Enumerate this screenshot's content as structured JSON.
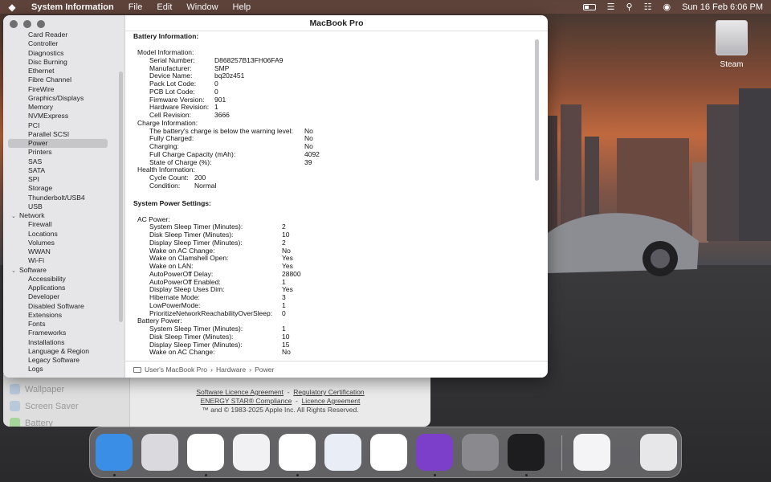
{
  "menubar": {
    "app_name": "System Information",
    "menus": [
      "File",
      "Edit",
      "Window",
      "Help"
    ],
    "clock": "Sun 16 Feb  6:06 PM"
  },
  "desktop": {
    "drive_label": "Steam"
  },
  "window": {
    "title": "MacBook Pro",
    "sidebar_items": [
      {
        "label": "Card Reader",
        "type": "child"
      },
      {
        "label": "Controller",
        "type": "child"
      },
      {
        "label": "Diagnostics",
        "type": "child"
      },
      {
        "label": "Disc Burning",
        "type": "child"
      },
      {
        "label": "Ethernet",
        "type": "child"
      },
      {
        "label": "Fibre Channel",
        "type": "child"
      },
      {
        "label": "FireWire",
        "type": "child"
      },
      {
        "label": "Graphics/Displays",
        "type": "child"
      },
      {
        "label": "Memory",
        "type": "child"
      },
      {
        "label": "NVMExpress",
        "type": "child"
      },
      {
        "label": "PCI",
        "type": "child"
      },
      {
        "label": "Parallel SCSI",
        "type": "child"
      },
      {
        "label": "Power",
        "type": "child",
        "selected": true
      },
      {
        "label": "Printers",
        "type": "child"
      },
      {
        "label": "SAS",
        "type": "child"
      },
      {
        "label": "SATA",
        "type": "child"
      },
      {
        "label": "SPI",
        "type": "child"
      },
      {
        "label": "Storage",
        "type": "child"
      },
      {
        "label": "Thunderbolt/USB4",
        "type": "child"
      },
      {
        "label": "USB",
        "type": "child"
      },
      {
        "label": "Network",
        "type": "group"
      },
      {
        "label": "Firewall",
        "type": "child"
      },
      {
        "label": "Locations",
        "type": "child"
      },
      {
        "label": "Volumes",
        "type": "child"
      },
      {
        "label": "WWAN",
        "type": "child"
      },
      {
        "label": "Wi-Fi",
        "type": "child"
      },
      {
        "label": "Software",
        "type": "group"
      },
      {
        "label": "Accessibility",
        "type": "child"
      },
      {
        "label": "Applications",
        "type": "child"
      },
      {
        "label": "Developer",
        "type": "child"
      },
      {
        "label": "Disabled Software",
        "type": "child"
      },
      {
        "label": "Extensions",
        "type": "child"
      },
      {
        "label": "Fonts",
        "type": "child"
      },
      {
        "label": "Frameworks",
        "type": "child"
      },
      {
        "label": "Installations",
        "type": "child"
      },
      {
        "label": "Language & Region",
        "type": "child"
      },
      {
        "label": "Legacy Software",
        "type": "child"
      },
      {
        "label": "Logs",
        "type": "child"
      }
    ],
    "battery_section_title": "Battery Information:",
    "model_group": "Model Information:",
    "model_rows": [
      {
        "k": "Serial Number:",
        "v": "D868257B13FH06FA9"
      },
      {
        "k": "Manufacturer:",
        "v": "SMP"
      },
      {
        "k": "Device Name:",
        "v": "bq20z451"
      },
      {
        "k": "Pack Lot Code:",
        "v": "0"
      },
      {
        "k": "PCB Lot Code:",
        "v": "0"
      },
      {
        "k": "Firmware Version:",
        "v": "901"
      },
      {
        "k": "Hardware Revision:",
        "v": "1"
      },
      {
        "k": "Cell Revision:",
        "v": "3666"
      }
    ],
    "charge_group": "Charge Information:",
    "charge_rows": [
      {
        "k": "The battery's charge is below the warning level:",
        "v": "No"
      },
      {
        "k": "Fully Charged:",
        "v": "No"
      },
      {
        "k": "Charging:",
        "v": "No"
      },
      {
        "k": "Full Charge Capacity (mAh):",
        "v": "4092"
      },
      {
        "k": "State of Charge (%):",
        "v": "39"
      }
    ],
    "health_group": "Health Information:",
    "health_rows": [
      {
        "k": "Cycle Count:",
        "v": "200"
      },
      {
        "k": "Condition:",
        "v": "Normal"
      }
    ],
    "power_section_title": "System Power Settings:",
    "ac_group": "AC Power:",
    "ac_rows": [
      {
        "k": "System Sleep Timer (Minutes):",
        "v": "2"
      },
      {
        "k": "Disk Sleep Timer (Minutes):",
        "v": "10"
      },
      {
        "k": "Display Sleep Timer (Minutes):",
        "v": "2"
      },
      {
        "k": "Wake on AC Change:",
        "v": "No"
      },
      {
        "k": "Wake on Clamshell Open:",
        "v": "Yes"
      },
      {
        "k": "Wake on LAN:",
        "v": "Yes"
      },
      {
        "k": "AutoPowerOff Delay:",
        "v": "28800"
      },
      {
        "k": "AutoPowerOff Enabled:",
        "v": "1"
      },
      {
        "k": "Display Sleep Uses Dim:",
        "v": "Yes"
      },
      {
        "k": "Hibernate Mode:",
        "v": "3"
      },
      {
        "k": "LowPowerMode:",
        "v": "1"
      },
      {
        "k": "PrioritizeNetworkReachabilityOverSleep:",
        "v": "0"
      }
    ],
    "battery_power_group": "Battery Power:",
    "battery_power_rows": [
      {
        "k": "System Sleep Timer (Minutes):",
        "v": "1"
      },
      {
        "k": "Disk Sleep Timer (Minutes):",
        "v": "10"
      },
      {
        "k": "Display Sleep Timer (Minutes):",
        "v": "15"
      },
      {
        "k": "Wake on AC Change:",
        "v": "No"
      }
    ],
    "path": [
      "User's MacBook Pro",
      "Hardware",
      "Power"
    ]
  },
  "back_window": {
    "sidebar": [
      "Wallpaper",
      "Screen Saver",
      "Battery"
    ],
    "link1": "Software Licence Agreement",
    "link2": "Regulatory Certification",
    "link3": "ENERGY STAR® Compliance",
    "link4": "Licence Agreement",
    "copyright": "™ and © 1983-2025 Apple Inc. All Rights Reserved."
  },
  "dock": {
    "apps": [
      {
        "name": "finder",
        "color": "#3a8ee6"
      },
      {
        "name": "launchpad",
        "color": "#d9d9de"
      },
      {
        "name": "chrome",
        "color": "#ffffff"
      },
      {
        "name": "xcode-instruments",
        "color": "#f1f1f4"
      },
      {
        "name": "vscode",
        "color": "#ffffff"
      },
      {
        "name": "postgres",
        "color": "#e9eef6"
      },
      {
        "name": "mongodb",
        "color": "#ffffff"
      },
      {
        "name": "github-desktop",
        "color": "#7b3fc9"
      },
      {
        "name": "system-settings",
        "color": "#8a8a8e"
      },
      {
        "name": "terminal",
        "color": "#1d1d1f"
      },
      {
        "name": "archive-utility",
        "color": "#f4f4f6"
      },
      {
        "name": "trash",
        "color": "#e7e7ea"
      }
    ]
  }
}
